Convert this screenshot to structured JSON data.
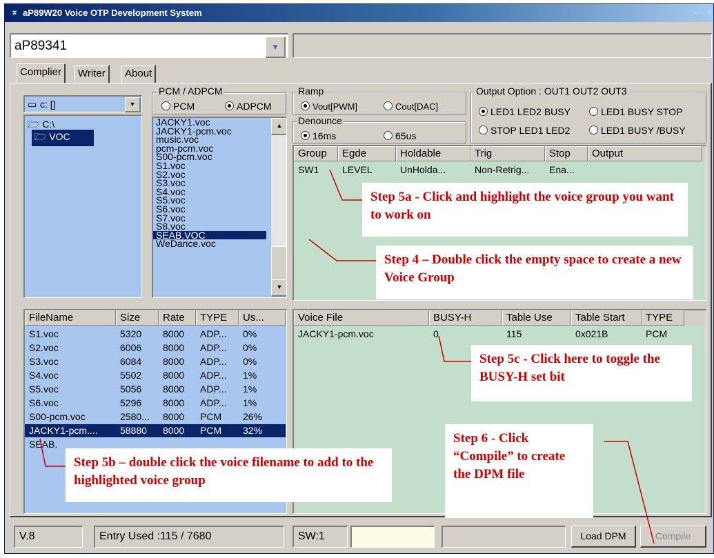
{
  "window": {
    "title": "aP89W20 Voice OTP Development System"
  },
  "device_select": {
    "value": "aP89341"
  },
  "tabs": [
    {
      "label": "Complier"
    },
    {
      "label": "Writer"
    },
    {
      "label": "About"
    }
  ],
  "drive_select": {
    "value": "c: []"
  },
  "folders": [
    {
      "label": "C:\\"
    },
    {
      "label": "VOC"
    }
  ],
  "pcm_adpcm": {
    "title": "PCM / ADPCM",
    "pcm": "PCM",
    "adpcm": "ADPCM",
    "selected": "ADPCM"
  },
  "file_list": [
    "JACKY1.voc",
    "JACKY1-pcm.voc",
    "music.voc",
    "pcm-pcm.voc",
    "S00-pcm.voc",
    "S1.voc",
    "S2.voc",
    "S3.voc",
    "S4.voc",
    "S5.voc",
    "S6.voc",
    "S7.voc",
    "S8.voc",
    "SEAB.VOC",
    "WeDance.voc"
  ],
  "file_list_selected": "SEAB.VOC",
  "ramp": {
    "title": "Ramp",
    "opt1": "Vout[PWM]",
    "opt2": "Cout[DAC]",
    "selected": "Vout[PWM]"
  },
  "denounce": {
    "title": "Denounce",
    "opt1": "16ms",
    "opt2": "65us",
    "selected": "16ms"
  },
  "output_option": {
    "title": "Output Option : OUT1 OUT2 OUT3",
    "opt1": "LED1 LED2 BUSY",
    "opt2": "LED1 BUSY STOP",
    "opt3": "STOP LED1 LED2",
    "opt4": "LED1 BUSY /BUSY",
    "selected": "LED1 LED2 BUSY"
  },
  "group_table": {
    "headers": [
      "Group",
      "Egde",
      "Holdable",
      "Trig",
      "Stop",
      "Output"
    ],
    "rows": [
      [
        "SW1",
        "LEVEL",
        "UnHolda...",
        "Non-Retrig...",
        "Ena...",
        ""
      ]
    ]
  },
  "voice_table": {
    "headers": [
      "FileName",
      "Size",
      "Rate",
      "TYPE",
      "Us..."
    ],
    "rows": [
      [
        "S1.voc",
        "5320",
        "8000",
        "ADP...",
        "0%"
      ],
      [
        "S2.voc",
        "6006",
        "8000",
        "ADP...",
        "0%"
      ],
      [
        "S3.voc",
        "6084",
        "8000",
        "ADP...",
        "0%"
      ],
      [
        "S4.voc",
        "5502",
        "8000",
        "ADP...",
        "1%"
      ],
      [
        "S5.voc",
        "5056",
        "8000",
        "ADP...",
        "1%"
      ],
      [
        "S6.voc",
        "5296",
        "8000",
        "ADP...",
        "1%"
      ],
      [
        "S00-pcm.voc",
        "2580...",
        "8000",
        "PCM",
        "26%"
      ],
      [
        "JACKY1-pcm....",
        "58880",
        "8000",
        "PCM",
        "32%"
      ],
      [
        "SEAB.",
        "",
        "",
        "",
        ""
      ]
    ],
    "selected_row": 7
  },
  "group_voice_table": {
    "headers": [
      "Voice File",
      "BUSY-H",
      "Table Use",
      "Table Start",
      "TYPE"
    ],
    "rows": [
      [
        "JACKY1-pcm.voc",
        "0",
        "115",
        "0x021B",
        "PCM"
      ]
    ]
  },
  "status": {
    "version": "V.8",
    "entry_used": "Entry Used :115 / 7680",
    "sw": "SW:1",
    "field1": "",
    "field2": ""
  },
  "buttons": {
    "load": "Load DPM",
    "compile": "Compile"
  },
  "callouts": {
    "step5a": "Step 5a - Click and highlight the voice group you want to work on",
    "step4": "Step 4 – Double click the empty space to create a new Voice Group",
    "step5c": "Step 5c - Click here to toggle the BUSY-H set bit",
    "step6": "Step 6 - Click “Compile” to create the DPM file",
    "step5b": "Step 5b – double click the voice filename to add to the highlighted voice group"
  },
  "colors": {
    "list_blue": "#a9c6ee",
    "panel_green": "#c3dfcb",
    "selection": "#0a246a",
    "callout_text": "#cc0000"
  }
}
